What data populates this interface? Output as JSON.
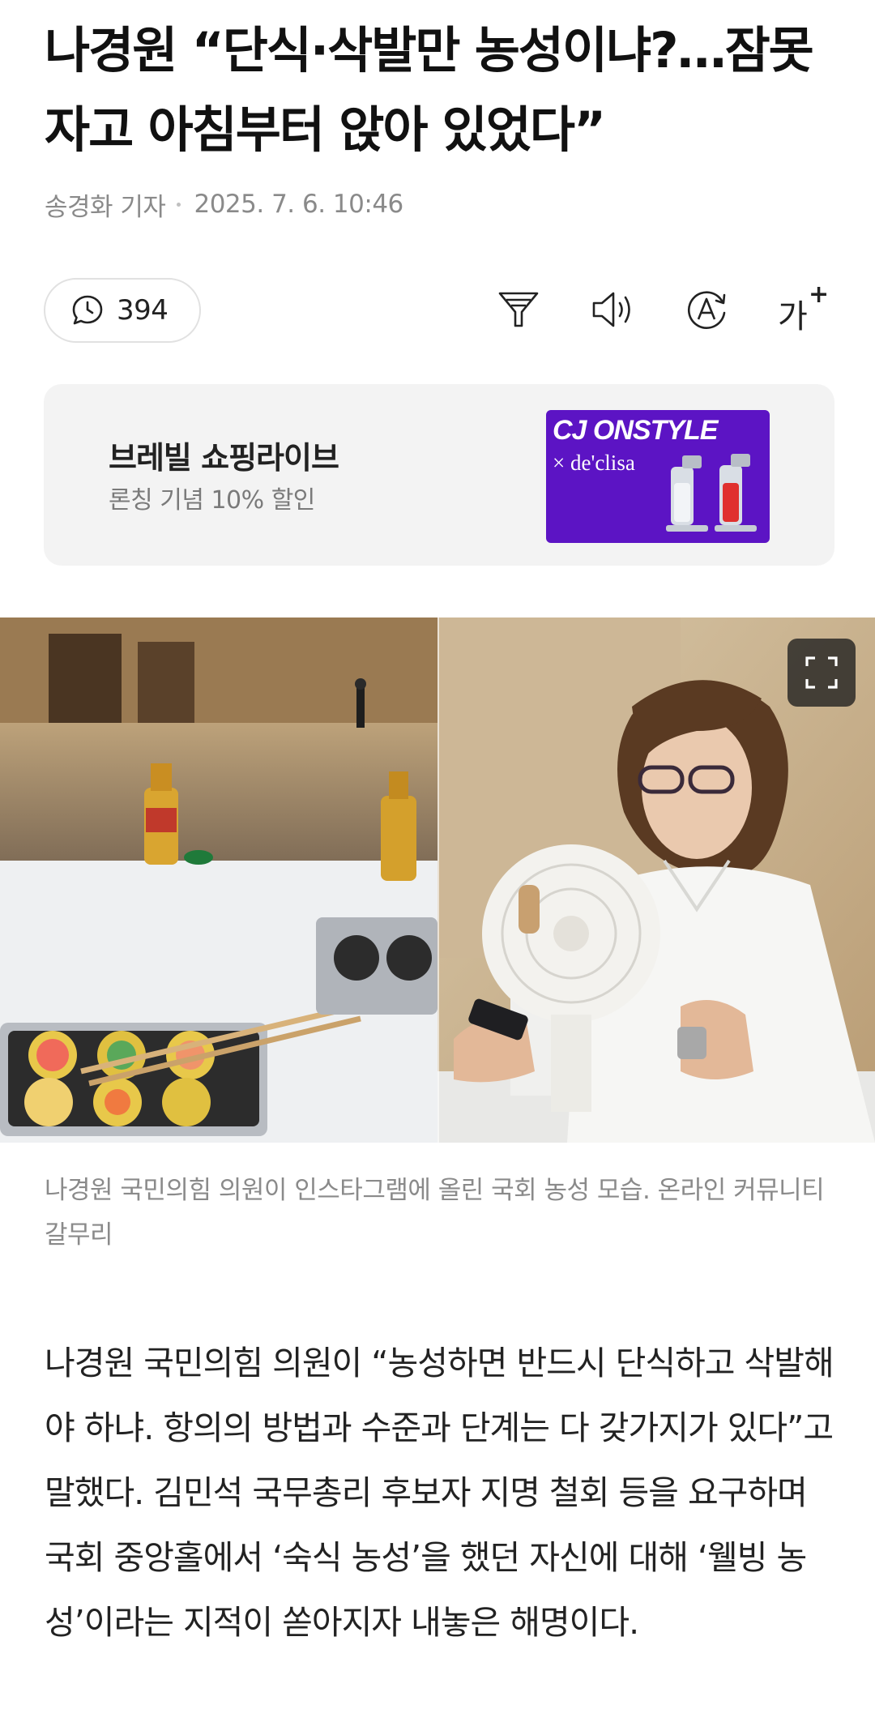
{
  "article": {
    "headline": "나경원 “단식·삭발만 농성이냐?…잠못 자고 아침부터 앉아 있었다”",
    "reporter": "송경화 기자",
    "date": "2025. 7. 6. 10:46",
    "comment_count": "394",
    "caption": "나경원 국민의힘 의원이 인스타그램에 올린 국회 농성 모습. 온라인 커뮤니티 갈무리",
    "body": "나경원 국민의힘 의원이 “농성하면 반드시 단식하고 삭발해야 하냐. 항의의 방법과 수준과 단계는 다 갖가지가 있다”고 말했다. 김민석 국무총리 후보자 지명 철회 등을 요구하며 국회 중앙홀에서 ‘숙식 농성’을 했던 자신에 대해 ‘웰빙 농성’이라는 지적이 쏟아지자 내놓은 해명이다."
  },
  "toolbar": {
    "comment_icon": "comment-icon",
    "filter_icon": "filter-icon",
    "tts_icon": "speaker-icon",
    "translate_icon": "translate-icon",
    "font_size_label": "가",
    "font_size_plus": "+"
  },
  "ad": {
    "title": "브레빌 쇼핑라이브",
    "subtitle": "론칭 기념 10% 할인",
    "brand": "CJ ONSTYLE",
    "collab": "× de'clisa",
    "bg_color": "#5c14c4"
  },
  "photo": {
    "expand_icon": "expand-icon"
  }
}
